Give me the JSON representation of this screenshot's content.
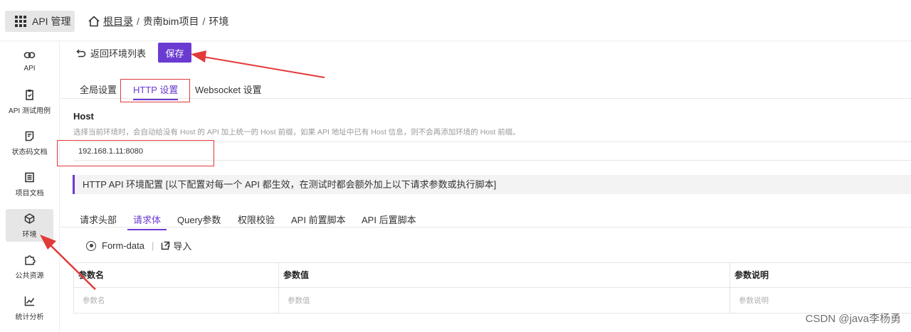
{
  "topbar": {
    "app_label": "API 管理",
    "breadcrumb": {
      "root": "根目录",
      "project": "贵南bim项目",
      "current": "环境",
      "separator": "/"
    }
  },
  "sidebar": {
    "items": [
      {
        "label": "API",
        "icon": "link-icon"
      },
      {
        "label": "API 测试用例",
        "icon": "clipboard-icon"
      },
      {
        "label": "状态码文档",
        "icon": "document-icon"
      },
      {
        "label": "项目文档",
        "icon": "list-document-icon"
      },
      {
        "label": "环境",
        "icon": "cube-icon",
        "active": true
      },
      {
        "label": "公共资源",
        "icon": "puzzle-icon"
      },
      {
        "label": "统计分析",
        "icon": "chart-icon"
      }
    ]
  },
  "header": {
    "back_label": "返回环境列表",
    "save_label": "保存"
  },
  "tabs": {
    "global": "全局设置",
    "http": "HTTP 设置",
    "websocket": "Websocket 设置",
    "active": "http"
  },
  "host": {
    "title": "Host",
    "description": "选择当前环境时，会自动给没有 Host 的 API 加上统一的 Host 前缀，如果 API 地址中已有 Host 信息，则不会再添加环境的 Host 前缀。",
    "value": "192.168.1.11:8080"
  },
  "section": {
    "title": "HTTP API 环境配置 [以下配置对每一个 API 都生效，在测试时都会额外加上以下请求参数或执行脚本]"
  },
  "sub_tabs": {
    "headers": "请求头部",
    "body": "请求体",
    "query": "Query参数",
    "auth": "权限校验",
    "pre_script": "API 前置脚本",
    "post_script": "API 后置脚本",
    "active": "body"
  },
  "toolbar": {
    "form_data": "Form-data",
    "separator": "|",
    "import": "导入"
  },
  "table": {
    "columns": [
      "参数名",
      "参数值",
      "参数说明"
    ],
    "placeholders": [
      "参数名",
      "参数值",
      "参数说明"
    ]
  },
  "watermark": "CSDN @java李杨勇",
  "colors": {
    "accent": "#6b3bd1",
    "annotation_red": "#e23a3a"
  }
}
